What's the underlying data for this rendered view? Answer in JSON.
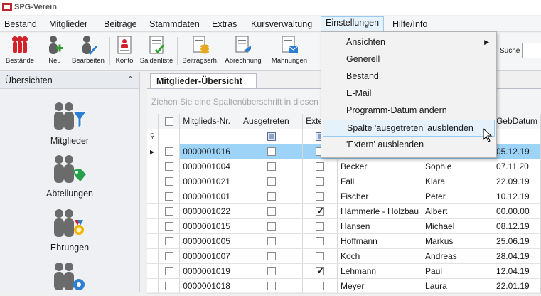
{
  "window": {
    "title": "SPG-Verein"
  },
  "menubar": [
    "Bestand",
    "Mitglieder",
    "Beiträge",
    "Stammdaten",
    "Extras",
    "Kursverwaltung",
    "Einstellungen",
    "Hilfe/Info"
  ],
  "toolbar": {
    "buttons": [
      {
        "label": "Bestände",
        "icon": "pins-icon"
      },
      {
        "label": "Neu",
        "icon": "add-person-icon"
      },
      {
        "label": "Bearbeiten",
        "icon": "edit-person-icon"
      },
      {
        "label": "Konto",
        "icon": "account-sheet-icon"
      },
      {
        "label": "Saldenliste",
        "icon": "balance-list-icon"
      },
      {
        "label": "Beitragserh.",
        "icon": "coins-icon"
      },
      {
        "label": "Abrechnung",
        "icon": "billing-icon"
      },
      {
        "label": "Mahnungen",
        "icon": "reminder-icon"
      }
    ],
    "search_label": "Suche"
  },
  "sidebar": {
    "title": "Übersichten",
    "items": [
      {
        "label": "Mitglieder",
        "icon": "members-filter-icon"
      },
      {
        "label": "Abteilungen",
        "icon": "departments-tag-icon"
      },
      {
        "label": "Ehrungen",
        "icon": "honors-medal-icon"
      },
      {
        "label": "",
        "icon": "settings-people-icon"
      }
    ]
  },
  "tab": {
    "label": "Mitglieder-Übersicht"
  },
  "grid": {
    "group_hint": "Ziehen Sie eine Spaltenüberschrift in diesen",
    "columns": [
      "Mitglieds-Nr.",
      "Ausgetreten",
      "Exte",
      "",
      "",
      "GebDatum"
    ],
    "rows": [
      {
        "nr": "0000001016",
        "ausgetreten": false,
        "extern": false,
        "name": "",
        "vorname": "",
        "geb": "05.12.19",
        "selected": true
      },
      {
        "nr": "0000001004",
        "ausgetreten": false,
        "extern": false,
        "name": "Becker",
        "vorname": "Sophie",
        "geb": "07.11.20"
      },
      {
        "nr": "0000001021",
        "ausgetreten": false,
        "extern": false,
        "name": "Fall",
        "vorname": "Klara",
        "geb": "22.09.19"
      },
      {
        "nr": "0000001001",
        "ausgetreten": false,
        "extern": false,
        "name": "Fischer",
        "vorname": "Peter",
        "geb": "10.12.19"
      },
      {
        "nr": "0000001022",
        "ausgetreten": false,
        "extern": true,
        "name": "Hämmerle - Holzbau",
        "vorname": "Albert",
        "geb": "00.00.00"
      },
      {
        "nr": "0000001015",
        "ausgetreten": false,
        "extern": false,
        "name": "Hansen",
        "vorname": "Michael",
        "geb": "08.12.19"
      },
      {
        "nr": "0000001005",
        "ausgetreten": false,
        "extern": false,
        "name": "Hoffmann",
        "vorname": "Markus",
        "geb": "25.06.19"
      },
      {
        "nr": "0000001007",
        "ausgetreten": false,
        "extern": false,
        "name": "Koch",
        "vorname": "Andreas",
        "geb": "28.04.19"
      },
      {
        "nr": "0000001019",
        "ausgetreten": false,
        "extern": true,
        "name": "Lehmann",
        "vorname": "Paul",
        "geb": "12.04.19"
      },
      {
        "nr": "0000001018",
        "ausgetreten": false,
        "extern": false,
        "name": "Meyer",
        "vorname": "Laura",
        "geb": "22.01.19"
      }
    ]
  },
  "dropdown": {
    "items": [
      "Ansichten",
      "Generell",
      "Bestand",
      "E-Mail",
      "Programm-Datum ändern",
      "Spalte 'ausgetreten' ausblenden",
      "'Extern' ausblenden"
    ],
    "highlighted_index": 5
  },
  "colors": {
    "accent": "#9cd3f7",
    "menu_hover": "#e5f1fb",
    "brand_red": "#c0262e"
  }
}
